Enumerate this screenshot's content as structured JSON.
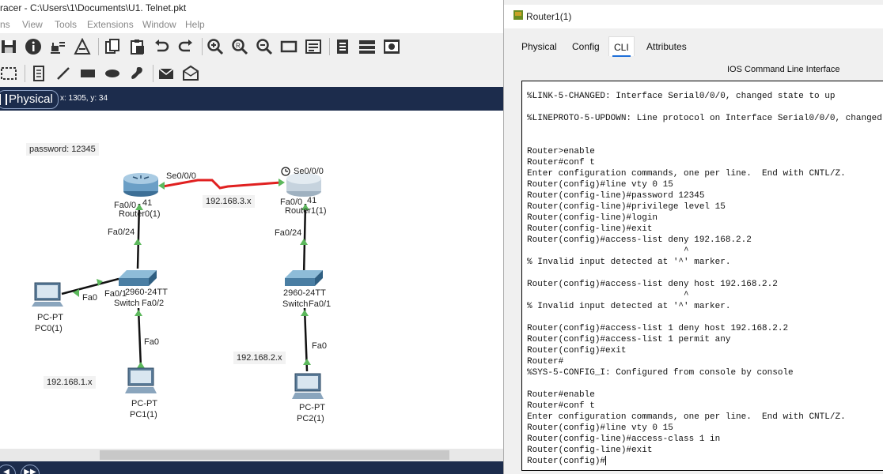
{
  "window": {
    "title": "racer - C:\\Users\\1\\Documents\\U1. Telnet.pkt"
  },
  "menu": [
    "ns",
    "View",
    "Tools",
    "Extensions",
    "Window",
    "Help"
  ],
  "viewbar": {
    "mode_label": "Physical",
    "coords": "x: 1305, y: 34"
  },
  "topology": {
    "notes": {
      "password": "password: 12345",
      "net_left": "192.168.1.x",
      "net_serial": "192.168.3.x",
      "net_right": "192.168.2.x"
    },
    "labels": {
      "r0_se": "Se0/0/0",
      "r0_fa": "Fa0/0",
      "r0_num": "41",
      "r0_name": "Router0(1)",
      "r1_se": "Se0/0/0",
      "r1_fa": "Fa0/0",
      "r1_num": "41",
      "r1_name": "Router1(1)",
      "sw0_up": "Fa0/24",
      "sw0_fa1": "Fa0/1",
      "sw0_model": "2960-24TT",
      "sw0_name": "Switch",
      "sw0_fa2": "Fa0/2",
      "sw1_up": "Fa0/24",
      "sw1_model": "2960-24TT",
      "sw1_name": "Switch",
      "sw1_fa1": "Fa0/1",
      "pc0_fa": "Fa0",
      "pc0_type": "PC-PT",
      "pc0_name": "PC0(1)",
      "pc1_fa": "Fa0",
      "pc1_type": "PC-PT",
      "pc1_name": "PC1(1)",
      "pc2_fa": "Fa0",
      "pc2_type": "PC-PT",
      "pc2_name": "PC2(1)"
    },
    "colors": {
      "serial_link": "#e02020",
      "link": "#111111",
      "up_marker": "#5cb85c",
      "header_bar": "#1c2c4c"
    }
  },
  "dialog": {
    "title": "Router1(1)",
    "tabs": [
      "Physical",
      "Config",
      "CLI",
      "Attributes"
    ],
    "active_tab": "CLI",
    "cli_header": "IOS Command Line Interface",
    "terminal": "%LINK-5-CHANGED: Interface Serial0/0/0, changed state to up\n\n%LINEPROTO-5-UPDOWN: Line protocol on Interface Serial0/0/0, changed state to up\n\n\nRouter>enable\nRouter#conf t\nEnter configuration commands, one per line.  End with CNTL/Z.\nRouter(config)#line vty 0 15\nRouter(config-line)#password 12345\nRouter(config-line)#privilege level 15\nRouter(config-line)#login\nRouter(config-line)#exit\nRouter(config)#access-list deny 192.168.2.2\n                              ^\n% Invalid input detected at '^' marker.\n\nRouter(config)#access-list deny host 192.168.2.2\n                              ^\n% Invalid input detected at '^' marker.\n\nRouter(config)#access-list 1 deny host 192.168.2.2\nRouter(config)#access-list 1 permit any\nRouter(config)#exit\nRouter#\n%SYS-5-CONFIG_I: Configured from console by console\n\nRouter#enable\nRouter#conf t\nEnter configuration commands, one per line.  End with CNTL/Z.\nRouter(config)#line vty 0 15\nRouter(config-line)#access-class 1 in\nRouter(config-line)#exit\nRouter(config)#"
  },
  "icons": [
    "save-icon",
    "info-icon",
    "network-info-icon",
    "activity-wizard-icon",
    "copy-icon",
    "paste-icon",
    "undo-icon",
    "redo-icon",
    "zoom-in-icon",
    "zoom-reset-icon",
    "zoom-out-icon",
    "rectangle-icon",
    "palette-icon",
    "notes-icon",
    "device-list-icon",
    "custom-device-icon",
    "select-icon",
    "note-icon",
    "line-icon",
    "draw-rectangle-icon",
    "draw-ellipse-icon",
    "freeform-icon",
    "inspect-icon",
    "delete-icon"
  ]
}
